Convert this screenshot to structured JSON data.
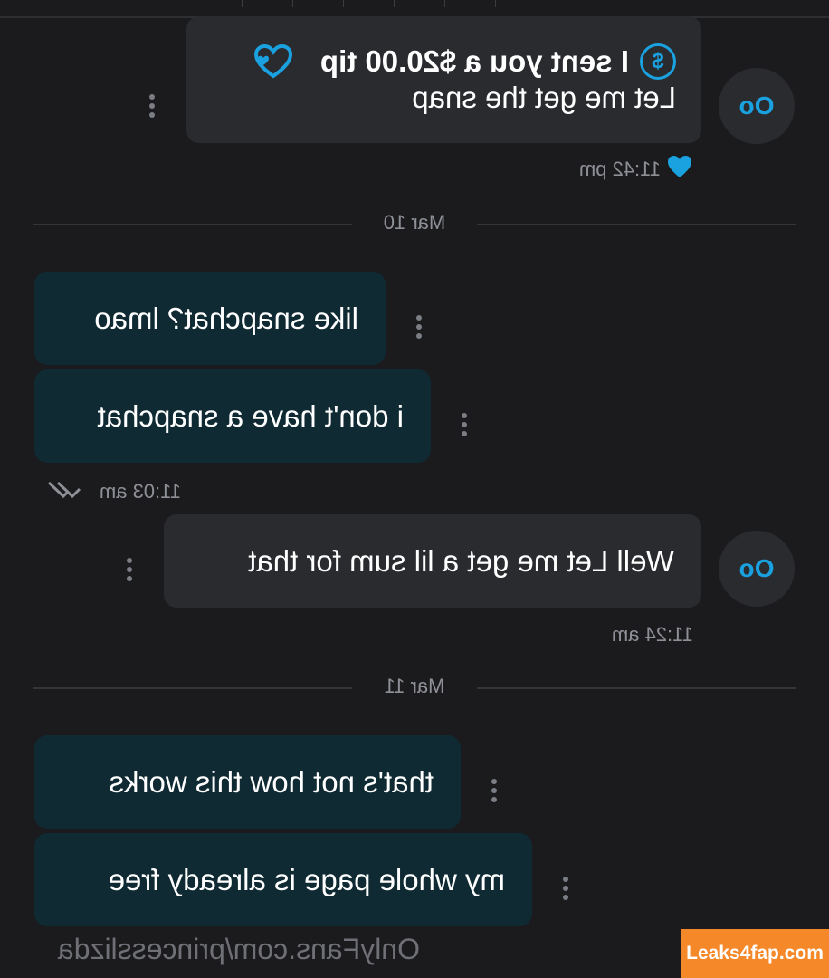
{
  "messages": {
    "tip": {
      "avatar": "Oo",
      "tip_text": "I sent you a $20.00 tip",
      "body": "Let me get the snap",
      "time": "11:42 pm",
      "coin_symbol": "$"
    },
    "date_1": "Mar 10",
    "in_1": "like snapchat? lmao",
    "in_2": "i don't have a snapchat",
    "in_time": "11:03 am",
    "out_2": {
      "avatar": "Oo",
      "body": "Well Let me get a lil sum for that",
      "time": "11:24 am"
    },
    "date_2": "Mar 11",
    "in_3": "that's not how this works",
    "in_4": "my whole page is already free"
  },
  "watermark": "OnlyFans.com/princesslizda",
  "badge": "Leaks4fap.com",
  "colors": {
    "accent": "#1aa1e0",
    "incoming_bubble": "#0f2a33",
    "outgoing_bubble": "#2a2b2f",
    "badge": "#f5892a"
  }
}
